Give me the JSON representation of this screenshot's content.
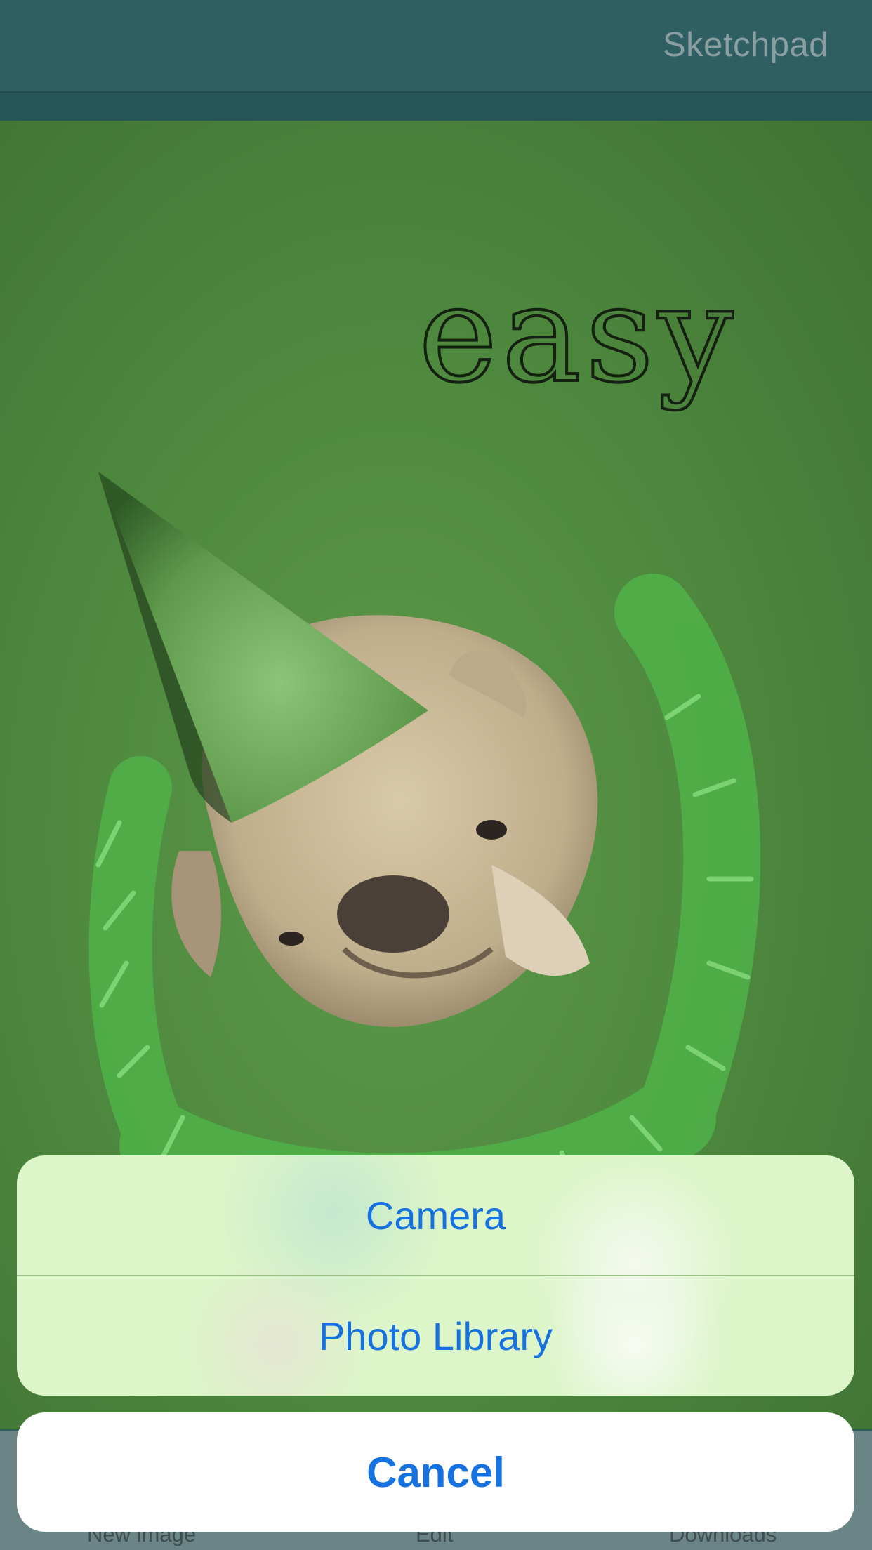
{
  "navbar": {
    "title": "Sketchpad"
  },
  "canvas": {
    "overlay_text": "easy",
    "background_color": "#4f8a3f"
  },
  "tabbar": {
    "items": [
      {
        "label": "New image"
      },
      {
        "label": "Edit"
      },
      {
        "label": "Downloads"
      }
    ]
  },
  "action_sheet": {
    "options": [
      {
        "label": "Camera"
      },
      {
        "label": "Photo Library"
      }
    ],
    "cancel_label": "Cancel",
    "accent_color": "#1672e0"
  }
}
